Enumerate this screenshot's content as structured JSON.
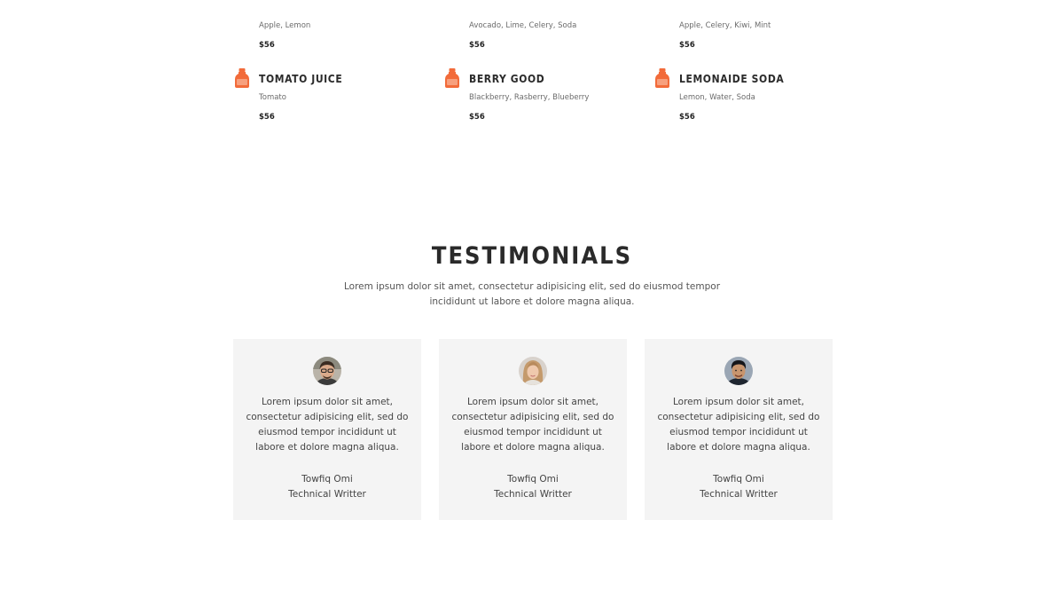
{
  "colors": {
    "accent": "#f26b3a",
    "accent_light": "#f7a07e",
    "card_background": "#f4f4f4",
    "heading": "#2a2a2a",
    "body_text": "#555555"
  },
  "menu": {
    "items": [
      {
        "name": "",
        "ingredients": "Apple, Lemon",
        "price": "$56",
        "icon": "juice-bottle-icon"
      },
      {
        "name": "",
        "ingredients": "Avocado, Lime, Celery, Soda",
        "price": "$56",
        "icon": "juice-bottle-icon"
      },
      {
        "name": "",
        "ingredients": "Apple, Celery, Kiwi, Mint",
        "price": "$56",
        "icon": "juice-bottle-icon"
      },
      {
        "name": "TOMATO JUICE",
        "ingredients": "Tomato",
        "price": "$56",
        "icon": "juice-bottle-icon"
      },
      {
        "name": "BERRY GOOD",
        "ingredients": "Blackberry, Rasberry, Blueberry",
        "price": "$56",
        "icon": "juice-bottle-icon"
      },
      {
        "name": "LEMONAIDE SODA",
        "ingredients": "Lemon, Water, Soda",
        "price": "$56",
        "icon": "juice-bottle-icon"
      }
    ]
  },
  "testimonials": {
    "title": "TESTIMONIALS",
    "subtitle": "Lorem ipsum dolor sit amet, consectetur adipisicing elit, sed do eiusmod tempor incididunt ut labore et dolore magna aliqua.",
    "cards": [
      {
        "quote": "Lorem ipsum dolor sit amet, consectetur adipisicing elit, sed do eiusmod tempor incididunt ut labore et dolore magna aliqua.",
        "name": "Towfiq Omi",
        "role": "Technical Writter",
        "avatar": "man-with-glasses-avatar"
      },
      {
        "quote": "Lorem ipsum dolor sit amet, consectetur adipisicing elit, sed do eiusmod tempor incididunt ut labore et dolore magna aliqua.",
        "name": "Towfiq Omi",
        "role": "Technical Writter",
        "avatar": "woman-with-blonde-hair-avatar"
      },
      {
        "quote": "Lorem ipsum dolor sit amet, consectetur adipisicing elit, sed do eiusmod tempor incididunt ut labore et dolore magna aliqua.",
        "name": "Towfiq Omi",
        "role": "Technical Writter",
        "avatar": "man-dark-hair-avatar"
      }
    ]
  }
}
